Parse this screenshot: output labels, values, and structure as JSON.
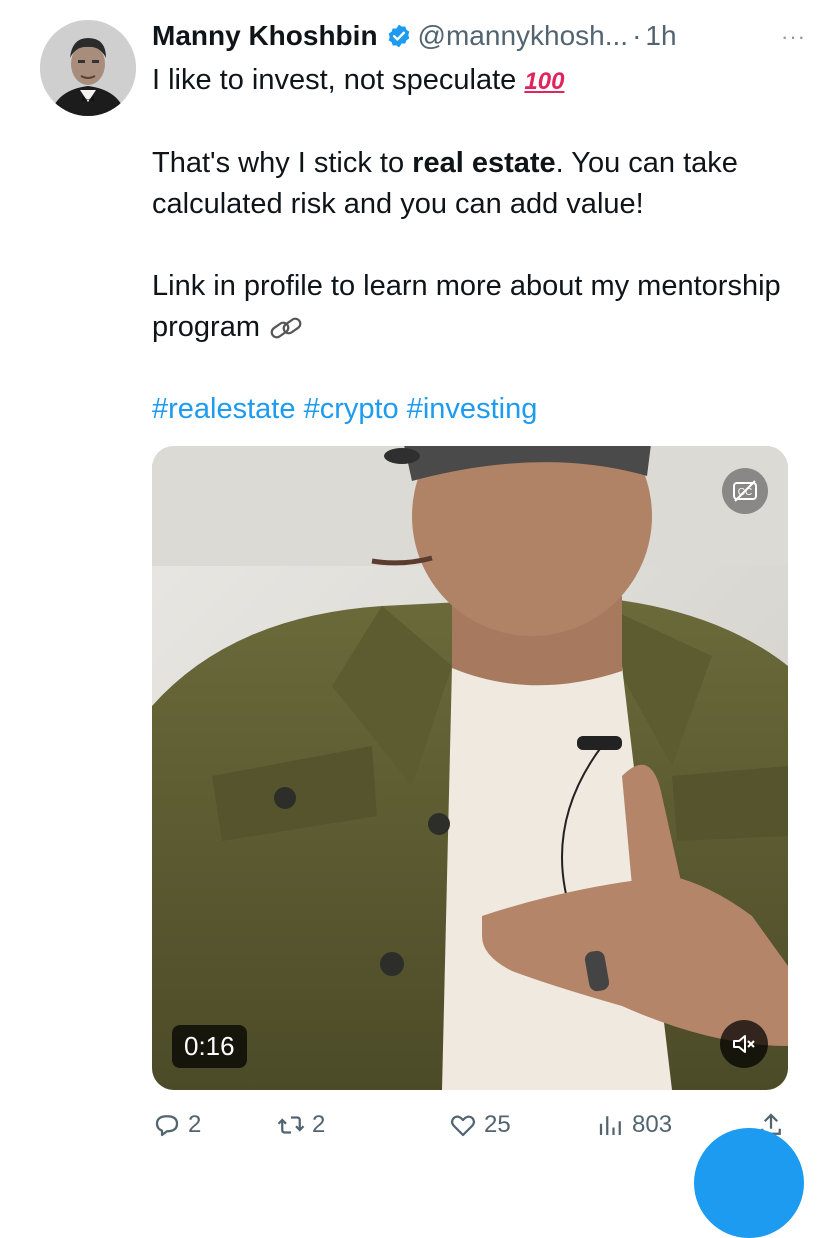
{
  "tweet": {
    "author_name": "Manny Khoshbin",
    "handle": "@mannykhosh...",
    "separator": "·",
    "time": "1h",
    "more_label": "···",
    "line1": "I like to invest, not speculate",
    "emoji_100": "100",
    "p2_before": "That's why I stick to ",
    "p2_bold": "real estate",
    "p2_after": ". You can take calculated risk and you can add value!",
    "p3": "Link in profile to learn more about my mentorship program",
    "hashtags": [
      "#realestate",
      "#crypto",
      "#investing"
    ]
  },
  "media": {
    "duration": "0:16",
    "cc_icon": "closed-captions-off-icon",
    "mute_icon": "muted-speaker-icon"
  },
  "actions": {
    "replies": "2",
    "retweets": "2",
    "likes": "25",
    "views": "803"
  },
  "colors": {
    "link": "#1d9bf0",
    "muted": "#536471",
    "verified": "#1d9bf0"
  }
}
